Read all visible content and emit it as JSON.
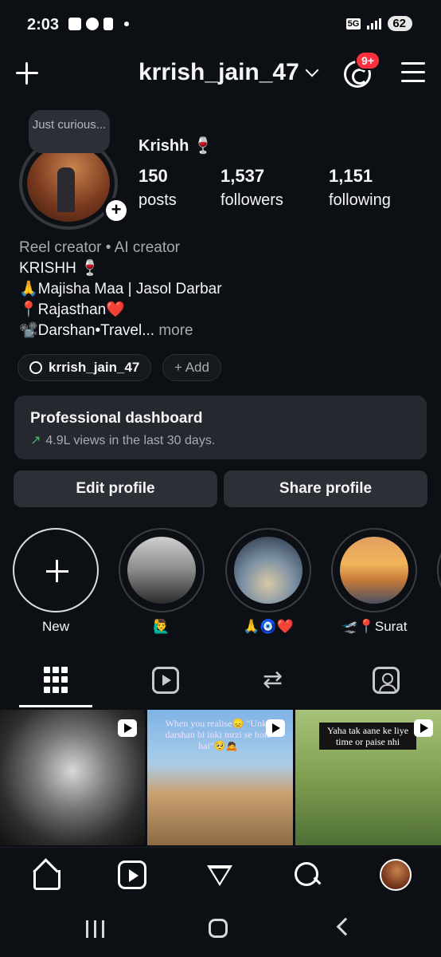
{
  "status_bar": {
    "time": "2:03",
    "network": "5G",
    "battery": "62"
  },
  "header": {
    "username": "krrish_jain_47",
    "notification_badge": "9+"
  },
  "profile": {
    "note": "Just curious...",
    "display_name": "Krishh 🍷",
    "stats": {
      "posts": {
        "value": "150",
        "label": "posts"
      },
      "followers": {
        "value": "1,537",
        "label": "followers"
      },
      "following": {
        "value": "1,151",
        "label": "following"
      }
    },
    "category": "Reel creator • AI creator",
    "bio_lines": [
      "KRISHH 🍷",
      "🙏Majisha Maa | Jasol Darbar",
      "📍Rajasthan❤️",
      "📽️Darshan•Travel..."
    ],
    "more_label": "more",
    "threads_handle": "krrish_jain_47",
    "add_label": "+ Add"
  },
  "dashboard": {
    "title": "Professional dashboard",
    "stats": "4.9L views in the last 30 days."
  },
  "actions": {
    "edit_profile": "Edit profile",
    "share_profile": "Share profile"
  },
  "highlights": [
    {
      "label": "New"
    },
    {
      "label": "🙋‍♂️"
    },
    {
      "label": "🙏🧿❤️"
    },
    {
      "label": "🛫📍Surat"
    }
  ],
  "posts": [
    {
      "caption": ""
    },
    {
      "caption": "When you realise😞\n\"Unke darshan bi inki mrzi se hote hai\"🥺🙇"
    },
    {
      "caption": "Yaha tak aane ke liye time or paise nhi"
    }
  ],
  "colors": {
    "background": "#0c0f14",
    "surface": "#2c2f35",
    "badge": "#ff3040",
    "trend_up": "#4cb36a"
  }
}
